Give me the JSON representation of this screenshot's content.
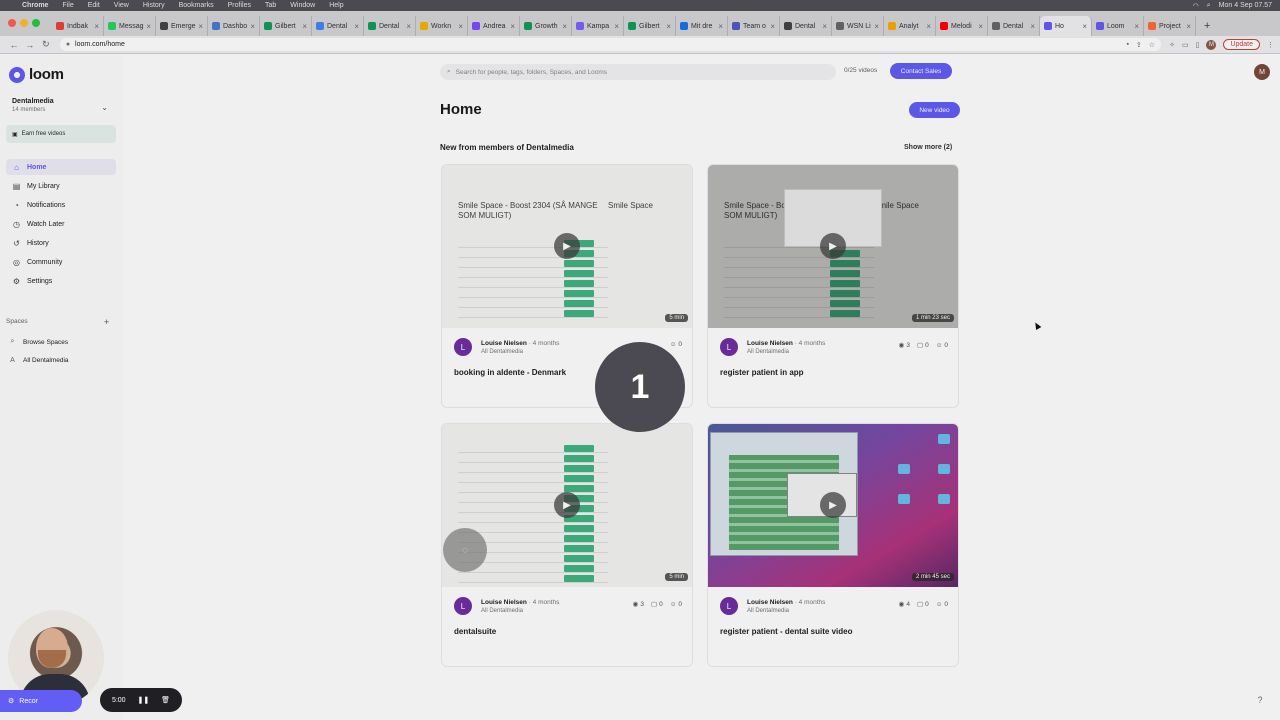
{
  "menubar": {
    "items": [
      "Chrome",
      "File",
      "Edit",
      "View",
      "History",
      "Bookmarks",
      "Profiles",
      "Tab",
      "Window",
      "Help"
    ],
    "clock": "Mon 4 Sep 07.57"
  },
  "tabs": [
    {
      "label": "Indbak",
      "color": "#ea4335"
    },
    {
      "label": "Messag",
      "color": "#25d366"
    },
    {
      "label": "Emerge",
      "color": "#444444"
    },
    {
      "label": "Dashbo",
      "color": "#4a7bd0"
    },
    {
      "label": "Gilbert",
      "color": "#0f9d58"
    },
    {
      "label": "Dental",
      "color": "#4285f4"
    },
    {
      "label": "Dental",
      "color": "#0f9d58"
    },
    {
      "label": "Workn",
      "color": "#f4b400"
    },
    {
      "label": "Andrea",
      "color": "#7c4dff"
    },
    {
      "label": "Growth",
      "color": "#0f9d58"
    },
    {
      "label": "Kampa",
      "color": "#7b61ff"
    },
    {
      "label": "Gilbert",
      "color": "#0f9d58"
    },
    {
      "label": "Mit dre",
      "color": "#1a73e8"
    },
    {
      "label": "Team o",
      "color": "#5059c9"
    },
    {
      "label": "Dental",
      "color": "#444444"
    },
    {
      "label": "WSN Li",
      "color": "#666666"
    },
    {
      "label": "Analyt",
      "color": "#f9ab00"
    },
    {
      "label": "Melodi",
      "color": "#ff0000"
    },
    {
      "label": "Dental",
      "color": "#666666"
    },
    {
      "label": "Ho",
      "color": "#625df5",
      "active": true
    },
    {
      "label": "Loom",
      "color": "#625df5"
    },
    {
      "label": "Project",
      "color": "#ff6b35"
    }
  ],
  "browser": {
    "url": "loom.com/home",
    "update_label": "Update",
    "profile_initial": "M"
  },
  "sidebar": {
    "logo_text": "loom",
    "workspace_name": "Dentalmedia",
    "workspace_members": "14 members",
    "earn_label": "Earn free videos",
    "nav": [
      {
        "label": "Home",
        "icon": "home-icon",
        "glyph": "⌂",
        "active": true
      },
      {
        "label": "My Library",
        "icon": "library-icon",
        "glyph": "▤"
      },
      {
        "label": "Notifications",
        "icon": "bell-icon",
        "glyph": "◔"
      },
      {
        "label": "Watch Later",
        "icon": "clock-icon",
        "glyph": "◷"
      },
      {
        "label": "History",
        "icon": "history-icon",
        "glyph": "↺"
      },
      {
        "label": "Community",
        "icon": "globe-icon",
        "glyph": "◎"
      },
      {
        "label": "Settings",
        "icon": "gear-icon",
        "glyph": "⚙"
      }
    ],
    "spaces_label": "Spaces",
    "spaces": [
      {
        "label": "Browse Spaces",
        "icon": "search-icon",
        "glyph": "⌕"
      },
      {
        "label": "All Dentalmedia",
        "icon": "space-icon",
        "glyph": "A"
      }
    ]
  },
  "header": {
    "search_placeholder": "Search for people, tags, folders, Spaces, and Looms",
    "video_count": "0/25 videos",
    "contact_sales": "Contact Sales",
    "avatar_initial": "M"
  },
  "main": {
    "title": "Home",
    "new_video": "New video",
    "section_title": "New from members of Dentalmedia",
    "show_more": "Show more (2)"
  },
  "videos": [
    {
      "title": "booking in aldente - Denmark",
      "author": "Louise Nielsen",
      "age": "· 4 months",
      "space": "All Dentalmedia",
      "avatar": "L",
      "views": "",
      "comments": "",
      "reactions": "0",
      "duration": "5 min",
      "thumb_heading": "Smile Space - Boost 2304 (SÅ MANGE SOM MULIGT)",
      "thumb_side": "Smile Space"
    },
    {
      "title": "register patient in app",
      "author": "Louise Nielsen",
      "age": "· 4 months",
      "space": "All Dentalmedia",
      "avatar": "L",
      "views": "3",
      "comments": "0",
      "reactions": "0",
      "duration": "1 min 23 sec",
      "thumb_heading": "Smile Space - Boost 2304 (SÅ MANGE SOM MULIGT)",
      "thumb_side": "Smile Space"
    },
    {
      "title": "dentalsuite",
      "author": "Louise Nielsen",
      "age": "· 4 months",
      "space": "All Dentalmedia",
      "avatar": "L",
      "views": "3",
      "comments": "0",
      "reactions": "0",
      "duration": "5 min",
      "thumb_heading": "",
      "thumb_side": ""
    },
    {
      "title": "register patient - dental suite video",
      "author": "Louise Nielsen",
      "age": "· 4 months",
      "space": "All Dentalmedia",
      "avatar": "L",
      "views": "4",
      "comments": "0",
      "reactions": "0",
      "duration": "2 min 45 sec",
      "thumb_heading": "",
      "thumb_side": ""
    }
  ],
  "recorder": {
    "countdown": "1",
    "timer": "5:00",
    "rec_label": "Recor"
  },
  "colors": {
    "accent": "#625df5",
    "avatar_purple": "#6f2ea3"
  }
}
